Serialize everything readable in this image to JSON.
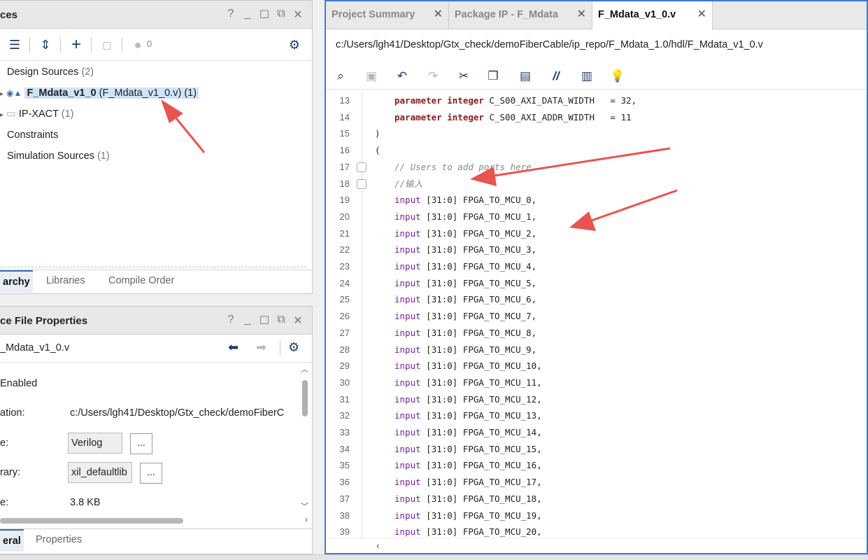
{
  "sources": {
    "title": "ces",
    "controls": [
      "?",
      "_",
      "☐",
      "⧉",
      "✕"
    ],
    "toolbar": {
      "badge_count": "0"
    },
    "tree": [
      {
        "label": "Design Sources",
        "count": "(2)"
      },
      {
        "label_bold": "F_Mdata_v1_0",
        "label_rest": " (F_Mdata_v1_0.v) (1)"
      },
      {
        "label": "IP-XACT",
        "count": "(1)"
      },
      {
        "label": "Constraints"
      },
      {
        "label": "Simulation Sources",
        "count": "(1)"
      }
    ],
    "tabs": [
      "archy",
      "Libraries",
      "Compile Order"
    ]
  },
  "properties": {
    "title": "ce File Properties",
    "controls": [
      "?",
      "_",
      "☐",
      "⧉",
      "✕"
    ],
    "file_name": "_Mdata_v1_0.v",
    "enabled_label": "Enabled",
    "rows": [
      {
        "label": "ation:",
        "value": "c:/Users/lgh41/Desktop/Gtx_check/demoFiberC"
      },
      {
        "label": "e:",
        "value": "Verilog"
      },
      {
        "label": "rary:",
        "value": "xil_defaultlib"
      },
      {
        "label": "e:",
        "value": "3.8 KB"
      }
    ],
    "dots": "...",
    "tabs": [
      "eral",
      "Properties"
    ]
  },
  "editor": {
    "tabs": [
      {
        "label": "Project Summary",
        "close": "✕"
      },
      {
        "label": "Package IP - F_Mdata",
        "close": "✕"
      },
      {
        "label": "F_Mdata_v1_0.v",
        "close": "✕"
      }
    ],
    "filepath": "c:/Users/lgh41/Desktop/Gtx_check/demoFiberCable/ip_repo/F_Mdata_1.0/hdl/F_Mdata_v1_0.v",
    "lines": [
      {
        "n": "13",
        "kw": "parameter integer",
        "rest": " C_S00_AXI_DATA_WIDTH   = 32,"
      },
      {
        "n": "14",
        "kw": "parameter integer",
        "rest": " C_S00_AXI_ADDR_WIDTH   = 11"
      },
      {
        "n": "15",
        "plain": ")"
      },
      {
        "n": "16",
        "plain": "("
      },
      {
        "n": "17",
        "comment": "// Users to add ports here"
      },
      {
        "n": "18",
        "comment": "//输入"
      },
      {
        "n": "19",
        "io": "input",
        "rest": " [31:0] FPGA_TO_MCU_0,"
      },
      {
        "n": "20",
        "io": "input",
        "rest": " [31:0] FPGA_TO_MCU_1,"
      },
      {
        "n": "21",
        "io": "input",
        "rest": " [31:0] FPGA_TO_MCU_2,"
      },
      {
        "n": "22",
        "io": "input",
        "rest": " [31:0] FPGA_TO_MCU_3,"
      },
      {
        "n": "23",
        "io": "input",
        "rest": " [31:0] FPGA_TO_MCU_4,"
      },
      {
        "n": "24",
        "io": "input",
        "rest": " [31:0] FPGA_TO_MCU_5,"
      },
      {
        "n": "25",
        "io": "input",
        "rest": " [31:0] FPGA_TO_MCU_6,"
      },
      {
        "n": "26",
        "io": "input",
        "rest": " [31:0] FPGA_TO_MCU_7,"
      },
      {
        "n": "27",
        "io": "input",
        "rest": " [31:0] FPGA_TO_MCU_8,"
      },
      {
        "n": "28",
        "io": "input",
        "rest": " [31:0] FPGA_TO_MCU_9,"
      },
      {
        "n": "29",
        "io": "input",
        "rest": " [31:0] FPGA_TO_MCU_10,"
      },
      {
        "n": "30",
        "io": "input",
        "rest": " [31:0] FPGA_TO_MCU_11,"
      },
      {
        "n": "31",
        "io": "input",
        "rest": " [31:0] FPGA_TO_MCU_12,"
      },
      {
        "n": "32",
        "io": "input",
        "rest": " [31:0] FPGA_TO_MCU_13,"
      },
      {
        "n": "33",
        "io": "input",
        "rest": " [31:0] FPGA_TO_MCU_14,"
      },
      {
        "n": "34",
        "io": "input",
        "rest": " [31:0] FPGA_TO_MCU_15,"
      },
      {
        "n": "35",
        "io": "input",
        "rest": " [31:0] FPGA_TO_MCU_16,"
      },
      {
        "n": "36",
        "io": "input",
        "rest": " [31:0] FPGA_TO_MCU_17,"
      },
      {
        "n": "37",
        "io": "input",
        "rest": " [31:0] FPGA_TO_MCU_18,"
      },
      {
        "n": "38",
        "io": "input",
        "rest": " [31:0] FPGA_TO_MCU_19,"
      },
      {
        "n": "39",
        "io": "input",
        "rest": " [31:0] FPGA_TO_MCU_20,"
      }
    ]
  },
  "colors": {
    "accent": "#3a7bd5",
    "annotation_arrow": "#e8544e",
    "keyword": "#8b1a1a",
    "port_keyword": "#7a1fa2",
    "selection": "#cfe3f9"
  }
}
